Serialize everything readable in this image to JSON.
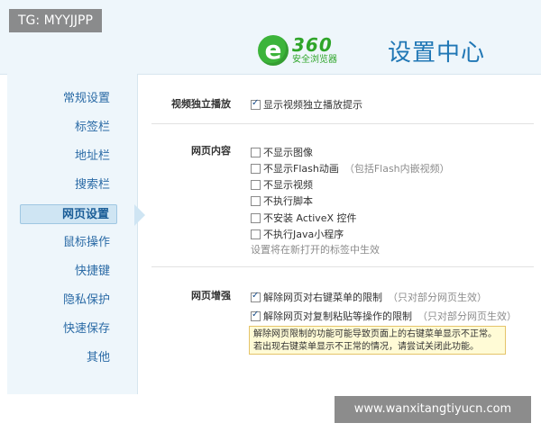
{
  "watermarks": {
    "top_left": "TG: MYYJJPP",
    "bottom_right": "www.wanxitangtiyucn.com"
  },
  "header": {
    "logo_letter": "e",
    "logo_number": "360",
    "logo_name": "安全浏览器",
    "title": "设置中心"
  },
  "sidebar": {
    "items": [
      "常规设置",
      "标签栏",
      "地址栏",
      "搜索栏",
      "网页设置",
      "鼠标操作",
      "快捷键",
      "隐私保护",
      "快速保存",
      "其他"
    ],
    "active": "网页设置"
  },
  "sections": {
    "video": {
      "label": "视频独立播放",
      "option": "显示视频独立播放提示",
      "checked": true
    },
    "content": {
      "label": "网页内容",
      "options": [
        {
          "text": "不显示图像",
          "hint": "",
          "checked": false
        },
        {
          "text": "不显示Flash动画",
          "hint": "（包括Flash内嵌视频）",
          "checked": false
        },
        {
          "text": "不显示视频",
          "hint": "",
          "checked": false
        },
        {
          "text": "不执行脚本",
          "hint": "",
          "checked": false
        },
        {
          "text": "不安装 ActiveX 控件",
          "hint": "",
          "checked": false
        },
        {
          "text": "不执行Java小程序",
          "hint": "",
          "checked": false
        }
      ],
      "note": "设置将在新打开的标签中生效"
    },
    "enhance": {
      "label": "网页增强",
      "options": [
        {
          "text": "解除网页对右键菜单的限制",
          "hint": "（只对部分网页生效）",
          "checked": true
        },
        {
          "text": "解除网页对复制粘贴等操作的限制",
          "hint": "（只对部分网页生效）",
          "checked": true
        }
      ],
      "warning_line1": "解除网页限制的功能可能导致页面上的右键菜单显示不正常。",
      "warning_line2": "若出现右键菜单显示不正常的情况，请尝试关闭此功能。"
    }
  }
}
